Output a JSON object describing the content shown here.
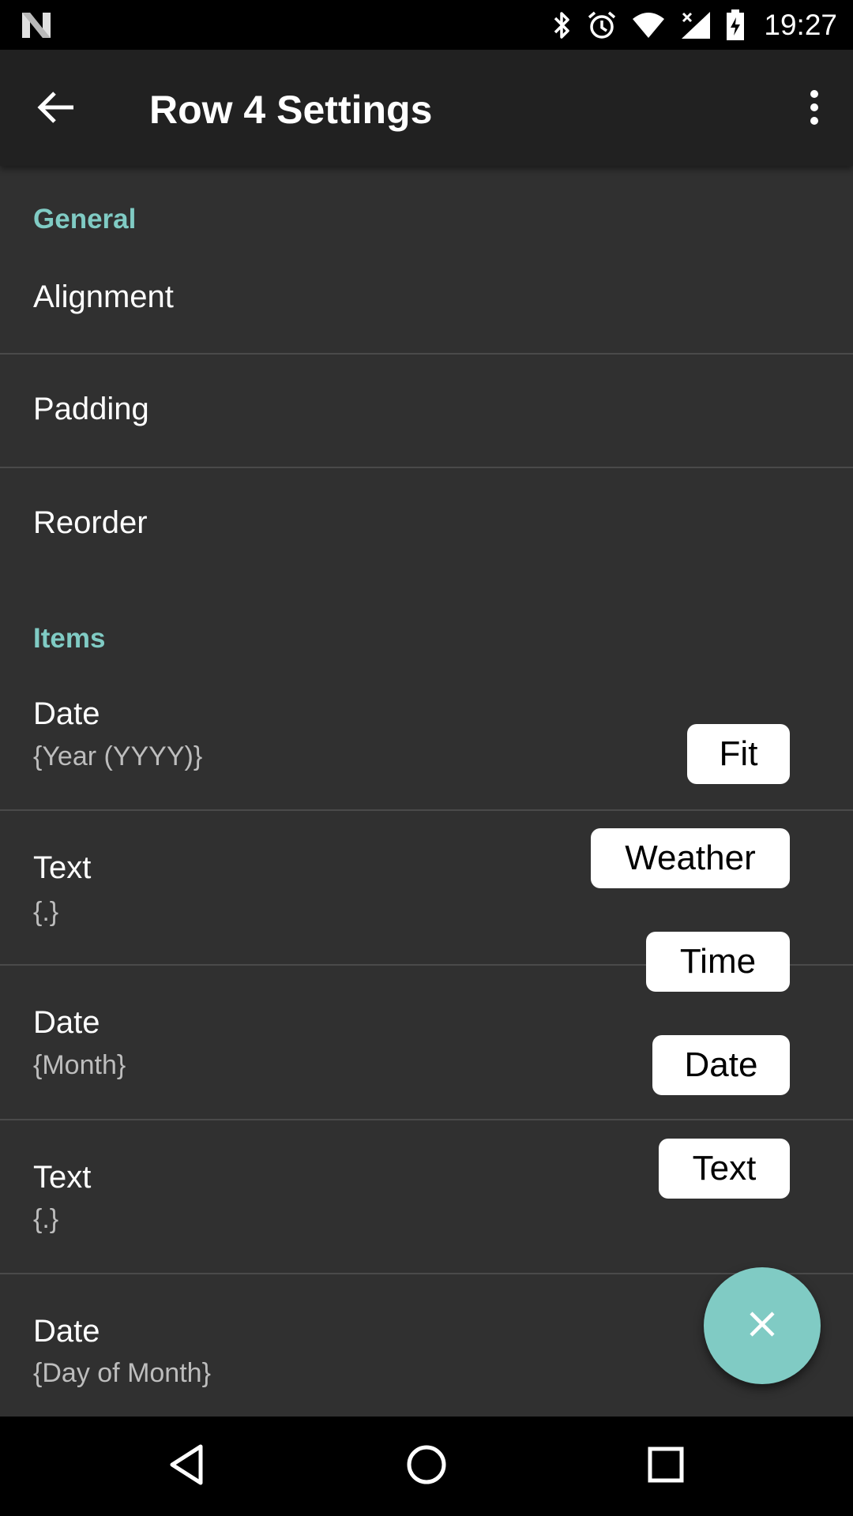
{
  "status_bar": {
    "time": "19:27",
    "icons": [
      "n-logo-icon",
      "bluetooth-icon",
      "alarm-icon",
      "wifi-icon",
      "signal-no-data-icon",
      "battery-charging-icon"
    ]
  },
  "app_bar": {
    "title": "Row 4 Settings",
    "back_icon": "arrow-back-icon",
    "menu_icon": "more-vert-icon"
  },
  "sections": {
    "general": {
      "header": "General",
      "items": [
        {
          "title": "Alignment"
        },
        {
          "title": "Padding"
        },
        {
          "title": "Reorder"
        }
      ]
    },
    "items": {
      "header": "Items",
      "items": [
        {
          "title": "Date",
          "subtitle": "{Year (YYYY)}"
        },
        {
          "title": "Text",
          "subtitle": "{.}"
        },
        {
          "title": "Date",
          "subtitle": "{Month}"
        },
        {
          "title": "Text",
          "subtitle": "{.}"
        },
        {
          "title": "Date",
          "subtitle": "{Day of Month}"
        }
      ]
    }
  },
  "fab_menu": {
    "options": [
      "Fit",
      "Weather",
      "Time",
      "Date",
      "Text"
    ],
    "close_icon": "close-icon"
  },
  "nav_bar": {
    "back": "nav-back-icon",
    "home": "nav-home-icon",
    "recents": "nav-recents-icon"
  },
  "colors": {
    "background": "#303030",
    "app_bar": "#212121",
    "accent": "#80cbc4",
    "chip": "#ffffff"
  }
}
